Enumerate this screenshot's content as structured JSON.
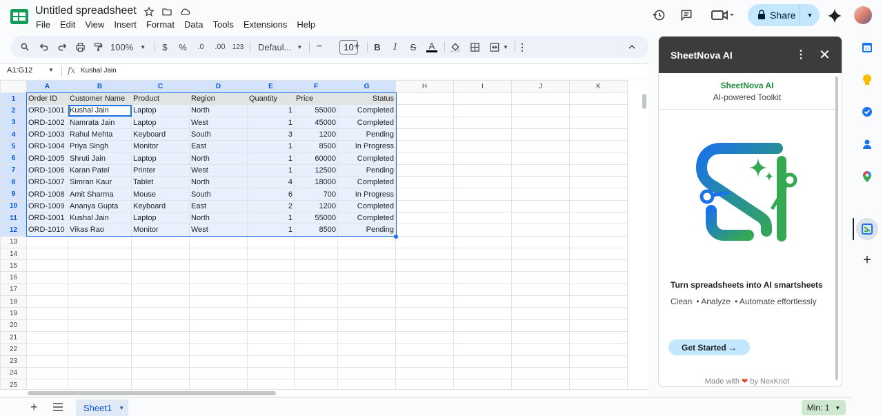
{
  "app": {
    "doc_title": "Untitled spreadsheet",
    "menu": [
      "File",
      "Edit",
      "View",
      "Insert",
      "Format",
      "Data",
      "Tools",
      "Extensions",
      "Help"
    ],
    "share_label": "Share"
  },
  "toolbar": {
    "zoom": "100%",
    "currency": "$",
    "percent": "%",
    "decrease_decimal": ".0",
    "increase_decimal": ".00",
    "number_format": "123",
    "font": "Defaul...",
    "font_size": "10",
    "bold": "B",
    "italic": "I",
    "strike": "S",
    "text_color": "A"
  },
  "formula_bar": {
    "name_box": "A1:G12",
    "fx": "fx",
    "content": "Kushal Jain"
  },
  "columns": [
    "A",
    "B",
    "C",
    "D",
    "E",
    "F",
    "G",
    "H",
    "I",
    "J",
    "K"
  ],
  "rows": [
    [
      "Order ID",
      "Customer Name",
      "Product",
      "Region",
      "Quantity",
      "Price",
      "Status"
    ],
    [
      "ORD-1001",
      "Kushal Jain",
      "Laptop",
      "North",
      "1",
      "55000",
      "Completed"
    ],
    [
      "ORD-1002",
      "Namrata Jain",
      "Laptop",
      "West",
      "1",
      "45000",
      "Completed"
    ],
    [
      "ORD-1003",
      "Rahul Mehta",
      "Keyboard",
      "South",
      "3",
      "1200",
      "Pending"
    ],
    [
      "ORD-1004",
      "Priya Singh",
      "Monitor",
      "East",
      "1",
      "8500",
      "In Progress"
    ],
    [
      "ORD-1005",
      "Shruti Jain",
      "Laptop",
      "North",
      "1",
      "60000",
      "Completed"
    ],
    [
      "ORD-1006",
      "Karan Patel",
      "Printer",
      "West",
      "1",
      "12500",
      "Pending"
    ],
    [
      "ORD-1007",
      "Simran Kaur",
      "Tablet",
      "North",
      "4",
      "18000",
      "Completed"
    ],
    [
      "ORD-1008",
      "Amit Sharma",
      "Mouse",
      "South",
      "6",
      "700",
      "In Progress"
    ],
    [
      "ORD-1009",
      "Ananya Gupta",
      "Keyboard",
      "East",
      "2",
      "1200",
      "Completed"
    ],
    [
      "ORD-1001",
      "Kushal Jain",
      "Laptop",
      "North",
      "1",
      "55000",
      "Completed"
    ],
    [
      "ORD-1010",
      "Vikas Rao",
      "Monitor",
      "West",
      "1",
      "8500",
      "Pending"
    ]
  ],
  "row_numbers": [
    "1",
    "2",
    "3",
    "4",
    "5",
    "6",
    "7",
    "8",
    "9",
    "10",
    "11",
    "12",
    "13",
    "14",
    "15",
    "16",
    "17",
    "18",
    "19",
    "20",
    "21",
    "22",
    "23",
    "24",
    "25"
  ],
  "sheet_tab": "Sheet1",
  "min_badge": "Min: 1",
  "panel": {
    "title": "SheetNova AI",
    "brand_name": "SheetNova AI",
    "brand_sub": "AI-powered Toolkit",
    "tagline": "Turn spreadsheets into AI smartsheets",
    "features": [
      "Clean",
      "• Analyze",
      "• Automate effortlessly"
    ],
    "cta": "Get Started →",
    "made_with": "Made with",
    "made_by": "by NexKnot"
  },
  "colors": {
    "accent": "#1a73e8",
    "share_bg": "#c2e7ff",
    "brand_green": "#1e8e3e",
    "selection": "#e8f0fe"
  }
}
